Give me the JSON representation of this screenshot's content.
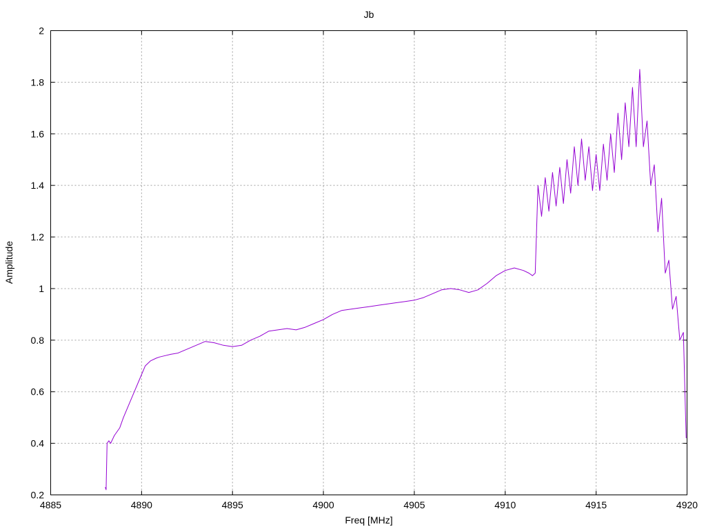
{
  "chart_data": {
    "type": "line",
    "title": "Jb",
    "xlabel": "Freq [MHz]",
    "ylabel": "Amplitude",
    "xlim": [
      4885,
      4920
    ],
    "ylim": [
      0.2,
      2.0
    ],
    "xticks": [
      4885,
      4890,
      4895,
      4900,
      4905,
      4910,
      4915,
      4920
    ],
    "xtick_labels": [
      "4885",
      "4890",
      "4895",
      "4900",
      "4905",
      "4910",
      "4915",
      "4920"
    ],
    "yticks": [
      0.2,
      0.4,
      0.6,
      0.8,
      1.0,
      1.2,
      1.4,
      1.6,
      1.8,
      2.0
    ],
    "ytick_labels": [
      "0.2",
      "0.4",
      "0.6",
      "0.8",
      "1",
      "1.2",
      "1.4",
      "1.6",
      "1.8",
      "2"
    ],
    "grid": true,
    "legend": "none",
    "color": "#9400d3",
    "series": [
      {
        "x": [
          4888.0,
          4888.05,
          4888.1,
          4888.2,
          4888.3,
          4888.5,
          4888.8,
          4889.0,
          4889.3,
          4889.6,
          4889.9,
          4890.2,
          4890.5,
          4890.8,
          4891.0,
          4891.3,
          4891.6,
          4892.0,
          4892.5,
          4893.0,
          4893.5,
          4894.0,
          4894.5,
          4895.0,
          4895.5,
          4896.0,
          4896.5,
          4897.0,
          4897.5,
          4898.0,
          4898.5,
          4899.0,
          4899.5,
          4900.0,
          4900.5,
          4901.0,
          4901.5,
          4902.0,
          4902.5,
          4903.0,
          4903.5,
          4904.0,
          4904.5,
          4905.0,
          4905.5,
          4906.0,
          4906.5,
          4907.0,
          4907.5,
          4908.0,
          4908.5,
          4909.0,
          4909.5,
          4910.0,
          4910.5,
          4911.0,
          4911.3,
          4911.5,
          4911.65,
          4911.8,
          4912.0,
          4912.2,
          4912.4,
          4912.6,
          4912.8,
          4913.0,
          4913.2,
          4913.4,
          4913.6,
          4913.8,
          4914.0,
          4914.2,
          4914.4,
          4914.6,
          4914.8,
          4915.0,
          4915.2,
          4915.4,
          4915.6,
          4915.8,
          4916.0,
          4916.2,
          4916.4,
          4916.6,
          4916.8,
          4917.0,
          4917.2,
          4917.4,
          4917.6,
          4917.8,
          4918.0,
          4918.2,
          4918.4,
          4918.6,
          4918.8,
          4919.0,
          4919.2,
          4919.4,
          4919.6,
          4919.8,
          4919.95
        ],
        "y": [
          0.23,
          0.22,
          0.4,
          0.41,
          0.4,
          0.43,
          0.46,
          0.5,
          0.55,
          0.6,
          0.65,
          0.7,
          0.72,
          0.73,
          0.735,
          0.74,
          0.745,
          0.75,
          0.765,
          0.78,
          0.795,
          0.79,
          0.78,
          0.775,
          0.78,
          0.8,
          0.815,
          0.835,
          0.84,
          0.845,
          0.84,
          0.85,
          0.865,
          0.88,
          0.9,
          0.915,
          0.92,
          0.925,
          0.93,
          0.935,
          0.94,
          0.945,
          0.95,
          0.955,
          0.965,
          0.98,
          0.995,
          1.0,
          0.995,
          0.985,
          0.995,
          1.02,
          1.05,
          1.07,
          1.08,
          1.07,
          1.06,
          1.05,
          1.06,
          1.4,
          1.28,
          1.43,
          1.3,
          1.45,
          1.32,
          1.47,
          1.33,
          1.5,
          1.37,
          1.55,
          1.4,
          1.58,
          1.42,
          1.55,
          1.38,
          1.52,
          1.38,
          1.56,
          1.42,
          1.6,
          1.45,
          1.68,
          1.5,
          1.72,
          1.55,
          1.78,
          1.55,
          1.85,
          1.55,
          1.65,
          1.4,
          1.48,
          1.22,
          1.35,
          1.06,
          1.11,
          0.92,
          0.97,
          0.8,
          0.83,
          0.42
        ]
      }
    ]
  }
}
